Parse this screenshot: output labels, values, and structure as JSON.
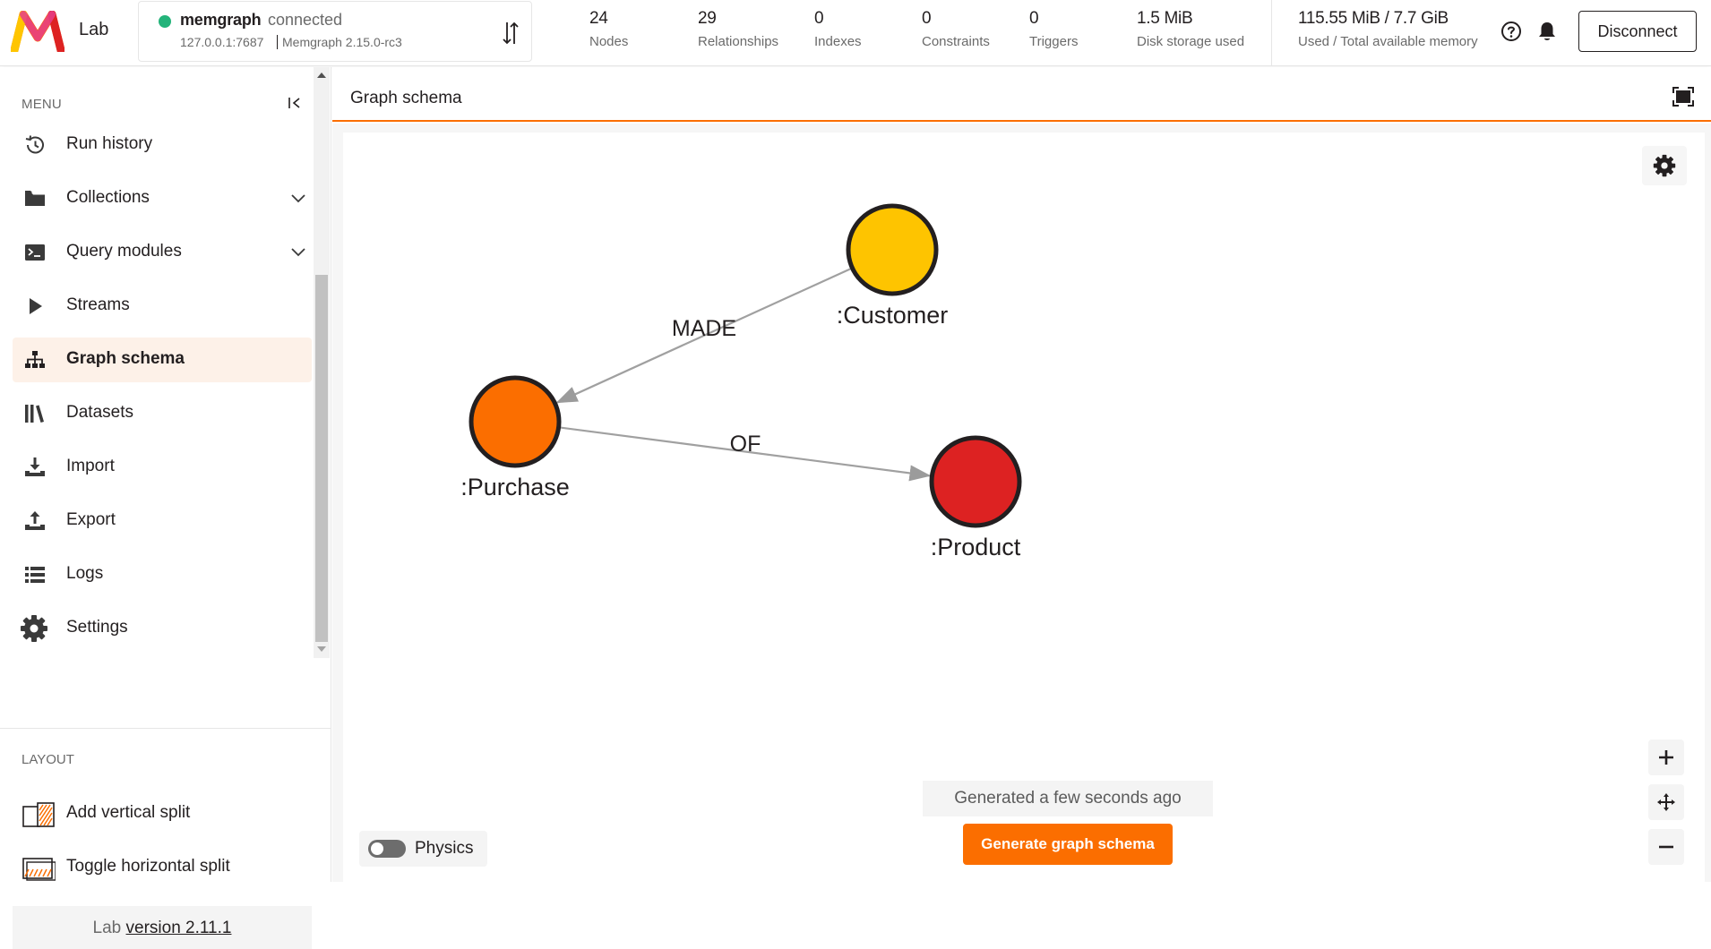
{
  "app": {
    "logo_text": "Lab",
    "accent_color": "#fb6e00"
  },
  "connection": {
    "name": "memgraph",
    "status": "connected",
    "status_color": "#23b37a",
    "host": "127.0.0.1:7687",
    "version": "Memgraph 2.15.0-rc3"
  },
  "stats": [
    {
      "value": "24",
      "label": "Nodes"
    },
    {
      "value": "29",
      "label": "Relationships"
    },
    {
      "value": "0",
      "label": "Indexes"
    },
    {
      "value": "0",
      "label": "Constraints"
    },
    {
      "value": "0",
      "label": "Triggers"
    },
    {
      "value": "1.5 MiB",
      "label": "Disk storage used"
    }
  ],
  "memory": {
    "value": "115.55 MiB / 7.7 GiB",
    "label": "Used / Total available memory"
  },
  "header_actions": {
    "help_icon": "help-circle-icon",
    "bell_icon": "bell-icon",
    "disconnect_label": "Disconnect"
  },
  "sidebar": {
    "menu_title": "MENU",
    "items": [
      {
        "label": "Run history",
        "icon": "history-icon",
        "active": false
      },
      {
        "label": "Collections",
        "icon": "folder-icon",
        "active": false,
        "expandable": true
      },
      {
        "label": "Query modules",
        "icon": "terminal-icon",
        "active": false,
        "expandable": true
      },
      {
        "label": "Streams",
        "icon": "play-icon",
        "active": false
      },
      {
        "label": "Graph schema",
        "icon": "sitemap-icon",
        "active": true
      },
      {
        "label": "Datasets",
        "icon": "library-icon",
        "active": false
      },
      {
        "label": "Import",
        "icon": "download-icon",
        "active": false
      },
      {
        "label": "Export",
        "icon": "upload-icon",
        "active": false
      },
      {
        "label": "Logs",
        "icon": "list-icon",
        "active": false
      },
      {
        "label": "Settings",
        "icon": "gear-icon",
        "active": false
      }
    ],
    "layout_title": "LAYOUT",
    "layout_items": [
      {
        "label": "Add vertical split",
        "icon": "vertical-split-icon"
      },
      {
        "label": "Toggle horizontal split",
        "icon": "horizontal-split-icon"
      }
    ],
    "version_prefix": "Lab",
    "version_link": "version 2.11.1"
  },
  "panel": {
    "title": "Graph schema",
    "physics_label": "Physics",
    "physics_enabled": false,
    "generated_status": "Generated a few seconds ago",
    "generate_button": "Generate graph schema"
  },
  "graph": {
    "nodes": [
      {
        "id": "customer",
        "label": ":Customer",
        "color": "#fec400"
      },
      {
        "id": "purchase",
        "label": ":Purchase",
        "color": "#fb6e00"
      },
      {
        "id": "product",
        "label": ":Product",
        "color": "#dd2222"
      }
    ],
    "edges": [
      {
        "from": "customer",
        "to": "purchase",
        "label": "MADE"
      },
      {
        "from": "purchase",
        "to": "product",
        "label": "OF"
      }
    ]
  }
}
